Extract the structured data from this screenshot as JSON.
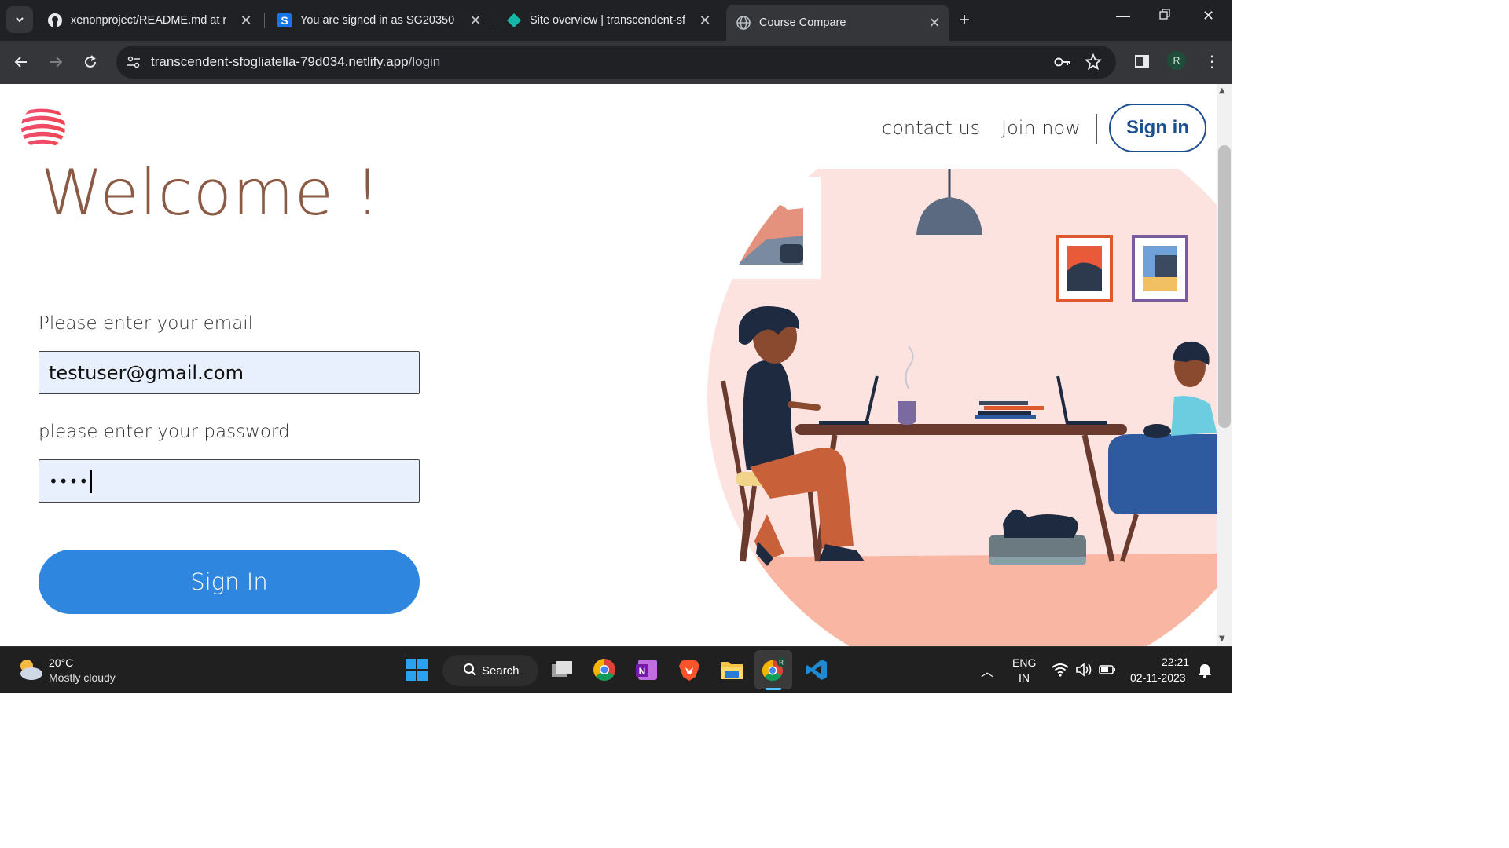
{
  "browser": {
    "tabs": [
      {
        "title": "xenonproject/README.md at r",
        "icon": "github-icon"
      },
      {
        "title": "You are signed in as SG20350",
        "icon": "s-app-icon"
      },
      {
        "title": "Site overview | transcendent-sf",
        "icon": "netlify-icon"
      },
      {
        "title": "Course Compare",
        "icon": "globe-icon",
        "active": true
      }
    ],
    "url_host": "transcendent-sfogliatella-79d034.netlify.app",
    "url_path": "/login",
    "profile_initial": "R"
  },
  "header": {
    "contact_label": "contact us",
    "join_label": "Join now",
    "signin_label": "Sign in"
  },
  "main": {
    "welcome": "Welcome !",
    "email_label": "Please enter your email",
    "email_value": "testuser@gmail.com",
    "password_label": "please enter your password",
    "password_value": "••••",
    "signin_button": "Sign In"
  },
  "taskbar": {
    "weather_temp": "20°C",
    "weather_desc": "Mostly cloudy",
    "search_label": "Search",
    "lang_line1": "ENG",
    "lang_line2": "IN",
    "time": "22:21",
    "date": "02-11-2023"
  },
  "colors": {
    "accent_blue": "#2e86de",
    "welcome_brown": "#8b5a44",
    "signin_outline": "#1b4f8f"
  }
}
